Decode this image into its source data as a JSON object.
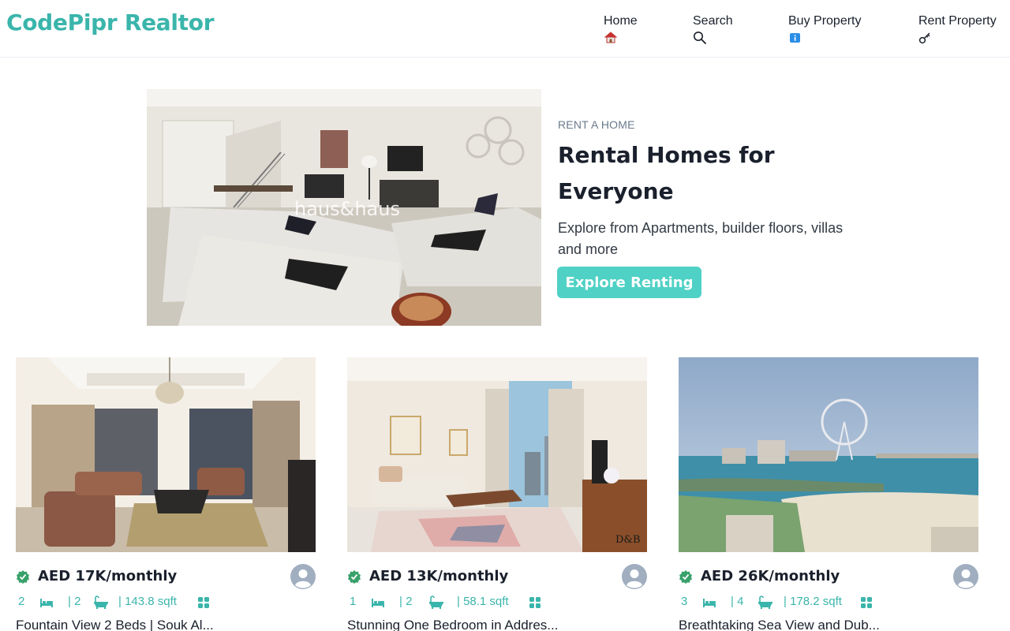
{
  "brand": {
    "name": "CodePipr Realtor"
  },
  "nav": {
    "home": "Home",
    "search": "Search",
    "buy": "Buy Property",
    "rent": "Rent Property"
  },
  "hero": {
    "kicker": "RENT A HOME",
    "title": "Rental Homes for Everyone",
    "description": "Explore from Apartments, builder floors, villas and more",
    "button": "Explore Renting",
    "image_watermark": "haus&haus"
  },
  "listings": [
    {
      "price": "AED 17K/monthly",
      "rooms": "2",
      "baths": "| 2",
      "area": "| 143.8 sqft",
      "title": "Fountain View 2 Beds | Souk Al..."
    },
    {
      "price": "AED 13K/monthly",
      "rooms": "1",
      "baths": "| 2",
      "area": "| 58.1 sqft",
      "title": "Stunning One Bedroom in Addres..."
    },
    {
      "price": "AED 26K/monthly",
      "rooms": "3",
      "baths": "| 4",
      "area": "| 178.2 sqft",
      "title": "Breathtaking Sea View and Dub..."
    }
  ],
  "colors": {
    "brand": "#3ab5ab",
    "button": "#4fd1c5",
    "verified": "#38a169",
    "avatar": "#a0aec0"
  },
  "icons": {
    "home": "home-icon",
    "search": "search-icon",
    "buy": "info-icon",
    "rent": "key-icon",
    "verified": "verified-check-icon",
    "bed": "bed-icon",
    "bath": "bath-icon",
    "area": "grid-icon",
    "avatar": "user-avatar-icon"
  }
}
